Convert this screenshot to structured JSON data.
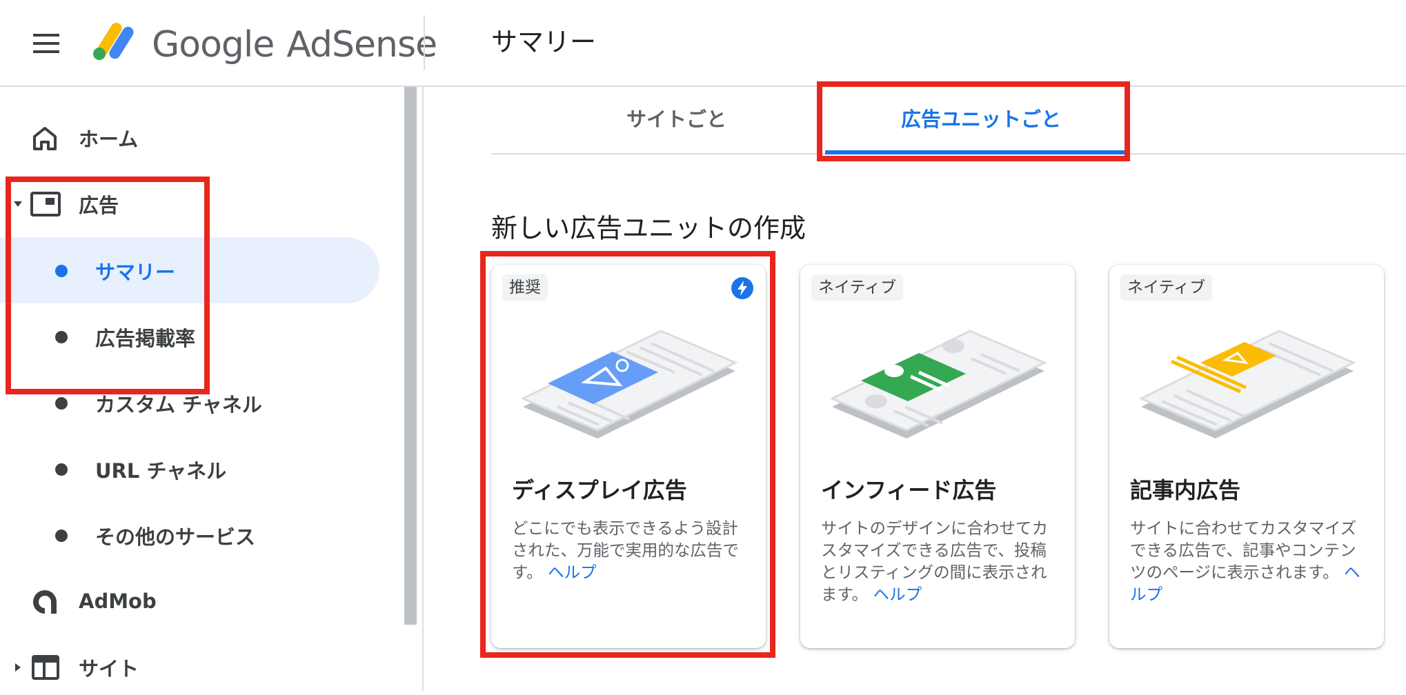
{
  "header": {
    "brand_google": "Google",
    "brand_product": "AdSense",
    "page_title": "サマリー"
  },
  "sidebar": {
    "home": "ホーム",
    "ads": "広告",
    "ads_children": [
      "サマリー",
      "広告掲載率",
      "カスタム チャネル",
      "URL チャネル",
      "その他のサービス"
    ],
    "admob": "AdMob",
    "sites": "サイト"
  },
  "tabs": {
    "by_site": "サイトごと",
    "by_ad_unit": "広告ユニットごと",
    "selected": "広告ユニットごと"
  },
  "section_title": "新しい広告ユニットの作成",
  "cards": [
    {
      "badge": "推奨",
      "title": "ディスプレイ広告",
      "desc": "どこにでも表示できるよう設計された、万能で実用的な広告です。",
      "help": "ヘルプ",
      "accent": "#669df6",
      "icon": "bolt-icon"
    },
    {
      "badge": "ネイティブ",
      "title": "インフィード広告",
      "desc": "サイトのデザインに合わせてカスタマイズできる広告で、投稿とリスティングの間に表示されます。",
      "help": "ヘルプ",
      "accent": "#34a853"
    },
    {
      "badge": "ネイティブ",
      "title": "記事内広告",
      "desc": "サイトに合わせてカスタマイズできる広告で、記事やコンテンツのページに表示されます。",
      "help": "ヘルプ",
      "accent": "#fbbc04"
    }
  ],
  "colors": {
    "highlight": "#e8261e",
    "primary": "#1a73e8",
    "active_bg": "#e8f0fe"
  }
}
